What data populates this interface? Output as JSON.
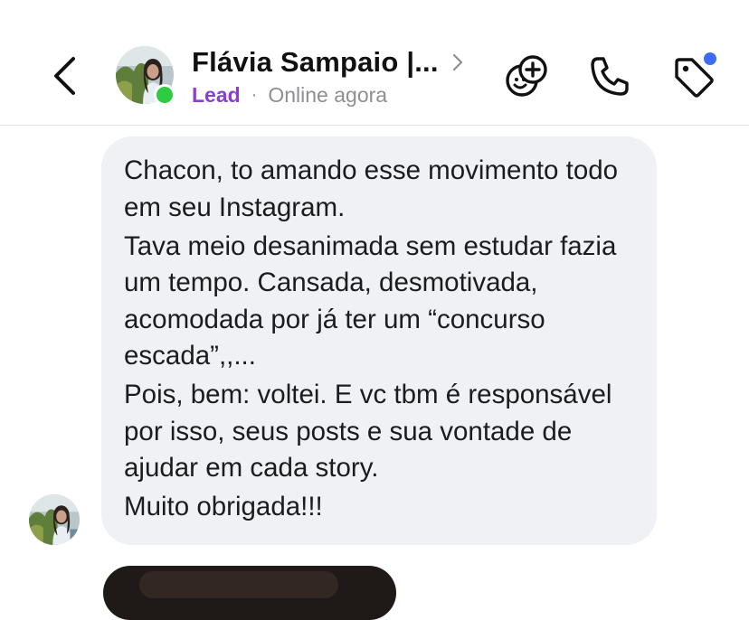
{
  "header": {
    "contact_name": "Flávia Sampaio |...",
    "label": "Lead",
    "separator": "·",
    "status": "Online agora"
  },
  "icons": {
    "back": "chevron-left-icon",
    "name_chevron": "chevron-right-icon",
    "sticker": "add-sticker-icon",
    "call": "phone-icon",
    "tag": "tag-icon"
  },
  "colors": {
    "lead_badge": "#8a3fd1",
    "online_indicator": "#2ecc40",
    "tag_notification_dot": "#3d6bf2",
    "bubble_background": "#eff1f4",
    "status_text": "#8e8e93"
  },
  "message": {
    "paragraphs": [
      "Chacon, to amando esse movimento todo em seu Instagram.",
      "Tava meio desanimada sem estudar fazia um tempo. Cansada, desmotivada, acomodada por já ter um “concurso escada”,,...",
      "Pois, bem: voltei. E vc tbm é responsável por isso, seus posts e sua vontade de ajudar em cada story.",
      "Muito obrigada!!!"
    ]
  }
}
